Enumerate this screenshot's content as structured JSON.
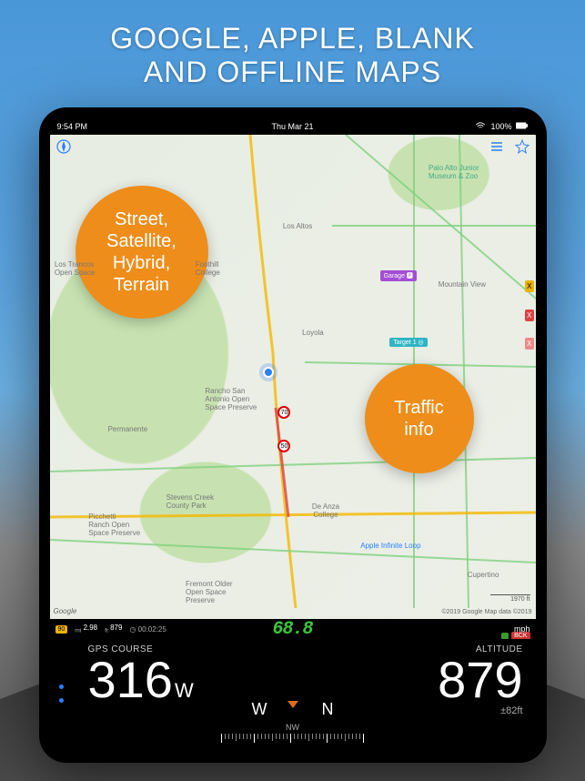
{
  "headline": {
    "line1": "GOOGLE, APPLE, BLANK",
    "line2": "AND OFFLINE MAPS"
  },
  "statusbar": {
    "time": "9:54 PM",
    "date": "Thu Mar 21",
    "battery": "100%",
    "battery_icon": "battery-full"
  },
  "callouts": {
    "map_types": "Street,\nSatellite,\nHybrid,\nTerrain",
    "traffic": "Traffic\ninfo"
  },
  "map": {
    "attribution_left": "Google",
    "attribution_right": "©2019 Google  Map data ©2019",
    "labels": {
      "los_altos": "Los Altos",
      "mountain_view": "Mountain View",
      "loyola": "Loyola",
      "permanente": "Permanente",
      "cupertino": "Cupertino",
      "rancho": "Rancho San\nAntonio Open\nSpace Preserve",
      "stevens": "Stevens Creek\nCounty Park",
      "foothill": "Foothill\nCollege",
      "deanza": "De Anza\nCollege",
      "apple_loop": "Apple Infinite Loop",
      "palo_alto_zoo": "Palo Alto Junior\nMuseum & Zoo",
      "fremont_osp": "Fremont Older\nOpen Space\nPreserve",
      "picchetti": "Picchetti\nRanch Open\nSpace Preserve",
      "los_trancos": "Los Trancos\nOpen Space"
    },
    "pois": {
      "garage": "Garage",
      "target1": "Target 1"
    },
    "speed_signs": [
      "70",
      "50"
    ],
    "side_badges": [
      "X",
      "X",
      "X"
    ],
    "scale_ft": "1970 ft"
  },
  "dashboard": {
    "badge_left": "90",
    "mi_label": "mi",
    "mi_val": "2.98",
    "ft_label": "ft",
    "ft_val": "879",
    "timer_icon": "clock",
    "timer": "00:02:25",
    "speed": "68.8",
    "unit_right": "mph",
    "bck_label": "BCK"
  },
  "bottom": {
    "course_label": "GPS COURSE",
    "course_val": "316",
    "course_unit": "W",
    "compass": {
      "left": "W",
      "center": "NW",
      "right": "N"
    },
    "altitude_label": "ALTITUDE",
    "altitude_val": "879",
    "altitude_err": "±82ft"
  },
  "colors": {
    "accent": "#ee8d1a",
    "speed_green": "#3bc43b",
    "blue": "#2a7fff"
  }
}
